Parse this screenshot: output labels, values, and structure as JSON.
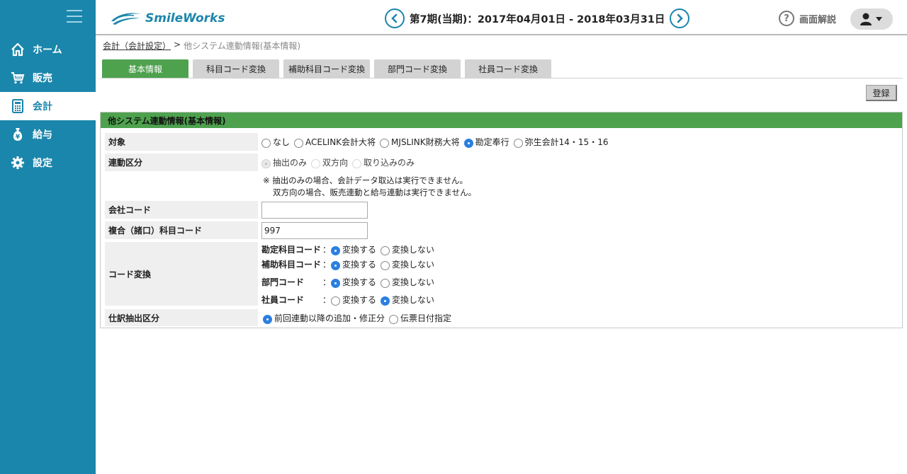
{
  "app": {
    "logo_text": "SmileWorks"
  },
  "header": {
    "period": "第7期(当期)：2017年04月01日 - 2018年03月31日",
    "help_label": "画面解説"
  },
  "sidebar": {
    "items": [
      {
        "label": "ホーム",
        "icon": "home-icon"
      },
      {
        "label": "販売",
        "icon": "cart-icon"
      },
      {
        "label": "会計",
        "icon": "calculator-icon",
        "active": true
      },
      {
        "label": "給与",
        "icon": "yen-bag-icon"
      },
      {
        "label": "設定",
        "icon": "gear-icon"
      }
    ]
  },
  "breadcrumb": {
    "link": "会計（会計設定）",
    "separator": ">",
    "current": "他システム連動情報(基本情報)"
  },
  "tabs": [
    {
      "label": "基本情報",
      "active": true
    },
    {
      "label": "科目コード変換"
    },
    {
      "label": "補助科目コード変換"
    },
    {
      "label": "部門コード変換"
    },
    {
      "label": "社員コード変換"
    }
  ],
  "toolbar": {
    "register_label": "登録"
  },
  "panel": {
    "title": "他システム連動情報(基本情報)",
    "target": {
      "label": "対象",
      "options": [
        "なし",
        "ACELINK会計大将",
        "MJSLINK財務大将",
        "勘定奉行",
        "弥生会計14・15・16"
      ],
      "selected": "勘定奉行"
    },
    "link_type": {
      "label": "連動区分",
      "options": [
        "抽出のみ",
        "双方向",
        "取り込みのみ"
      ],
      "selected": "抽出のみ",
      "note_1": "※ 抽出のみの場合、会計データ取込は実行できません。",
      "note_2": "双方向の場合、販売連動と給与連動は実行できません。"
    },
    "company_code": {
      "label": "会社コード",
      "value": ""
    },
    "compound_code": {
      "label": "複合（諸口）科目コード",
      "value": "997"
    },
    "code_conversion": {
      "label": "コード変換",
      "colon": "：",
      "rows": [
        {
          "name": "勘定科目コード",
          "convert": "変換する",
          "no_convert": "変換しない",
          "selected": "変換する"
        },
        {
          "name": "補助科目コード",
          "convert": "変換する",
          "no_convert": "変換しない",
          "selected": "変換する"
        },
        {
          "name": "部門コード",
          "convert": "変換する",
          "no_convert": "変換しない",
          "selected": "変換する"
        },
        {
          "name": "社員コード",
          "convert": "変換する",
          "no_convert": "変換しない",
          "selected": "変換しない"
        }
      ]
    },
    "journal_extract": {
      "label": "仕訳抽出区分",
      "options": [
        "前回連動以降の追加・修正分",
        "伝票日付指定"
      ],
      "selected": "前回連動以降の追加・修正分"
    }
  },
  "colors": {
    "sidebar": "#1b86ab",
    "accent_green": "#4ea24e",
    "radio_blue": "#2b7fe0"
  }
}
